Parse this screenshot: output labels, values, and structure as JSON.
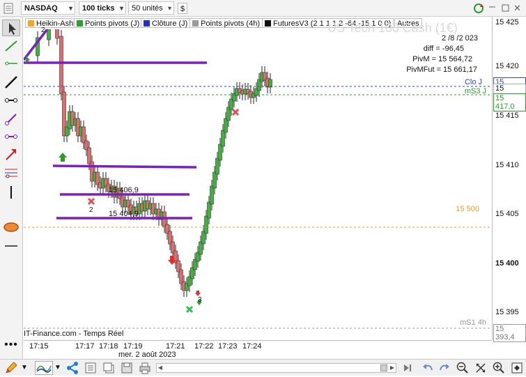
{
  "toolbar": {
    "symbol": "NASDAQ",
    "ticks": "100 ticks",
    "units": "50 unités",
    "small_symbol": "$"
  },
  "legend": [
    {
      "label": "Heikin-Ashi",
      "color": "#f5a623"
    },
    {
      "label": "Points pivots (J)",
      "color": "#2aa02a"
    },
    {
      "label": "Clôture (J)",
      "color": "#2030d0"
    },
    {
      "label": "Points pivots (4h)",
      "color": "#9a9a9a"
    },
    {
      "label": "FuturesV3 (2 1 1 1 2 -64 -15 1 0 0)",
      "color": "#111111"
    },
    {
      "label": "Autres",
      "color": ""
    }
  ],
  "watermark": "US Tech 100 Cash (1€)",
  "info": {
    "date": "2 /8 /2 023",
    "diff": "diff = -96,45",
    "pivm": "PivM = 15 564,72",
    "pivmfut": "PivMFut = 15 661,17"
  },
  "chart_labels": {
    "clo_j": "Clo J",
    "ms3_j": "mS3 J",
    "level_15500": "15 500",
    "ms1_4h": "mS1 4h",
    "ann_15406": "15 406,9",
    "ann_15404": "15 404,9",
    "sig2_a": "2",
    "sig2_b": "2",
    "sig3": "3"
  },
  "yaxis": {
    "ticks": [
      "15 425",
      "15 420",
      "15 415",
      "15 410",
      "15 405",
      "15 400",
      "15 395"
    ],
    "box_clo": "15 418,0",
    "box_price": "15 417,9",
    "box_ms3": "15 417,0",
    "box_ms1": "15 393,4"
  },
  "xaxis": {
    "ticks": [
      "17:15",
      "17:17",
      "17:18",
      "17:19",
      "17:21",
      "17:22",
      "17:23",
      "17:24"
    ],
    "date": "mer. 2 août 2023"
  },
  "source": "IT-Finance.com - Temps Réel",
  "colors": {
    "up": "#3db53d",
    "down": "#e06d6d",
    "purple": "#7a1fc2",
    "blue_dash": "#3040c0",
    "green_dash": "#2a9a2a",
    "orange_dash": "#e8a020",
    "gray_dash": "#999999"
  }
}
